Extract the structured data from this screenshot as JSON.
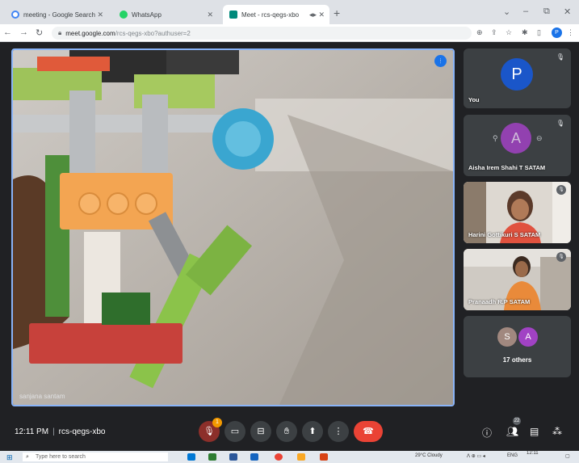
{
  "browser": {
    "tabs": [
      {
        "title": "meeting - Google Search",
        "favicon_color": "#4285f4"
      },
      {
        "title": "WhatsApp",
        "favicon_color": "#25d366"
      },
      {
        "title": "Meet - rcs-qegs-xbo",
        "favicon_color": "#00897b"
      }
    ],
    "new_tab_label": "+",
    "address_host": "meet.google.com",
    "address_path": "/rcs-qegs-xbo?authuser=2",
    "profile_initial": "P"
  },
  "meet": {
    "main_video_name": "sanjana santam",
    "participants": [
      {
        "name": "You",
        "initial": "P",
        "avatar_color": "#1a56c9"
      },
      {
        "name": "Aisha Irem Shahi T SATAM",
        "initial": "A",
        "avatar_color": "#a142c4"
      },
      {
        "name": "Harini Gottikuri S SATAM"
      },
      {
        "name": "Pranaadh R.P SATAM"
      }
    ],
    "others": {
      "initials": [
        "S",
        "A"
      ],
      "colors": [
        "#a1887f",
        "#a142c4"
      ],
      "label": "17 others"
    },
    "time": "12:11 PM",
    "meeting_code": "rcs-qegs-xbo",
    "participant_count": "22",
    "reactions_badge": "1"
  },
  "taskbar": {
    "search_placeholder": "Type here to search",
    "weather": "29°C Cloudy",
    "language": "ENG",
    "clock": "12:11"
  }
}
